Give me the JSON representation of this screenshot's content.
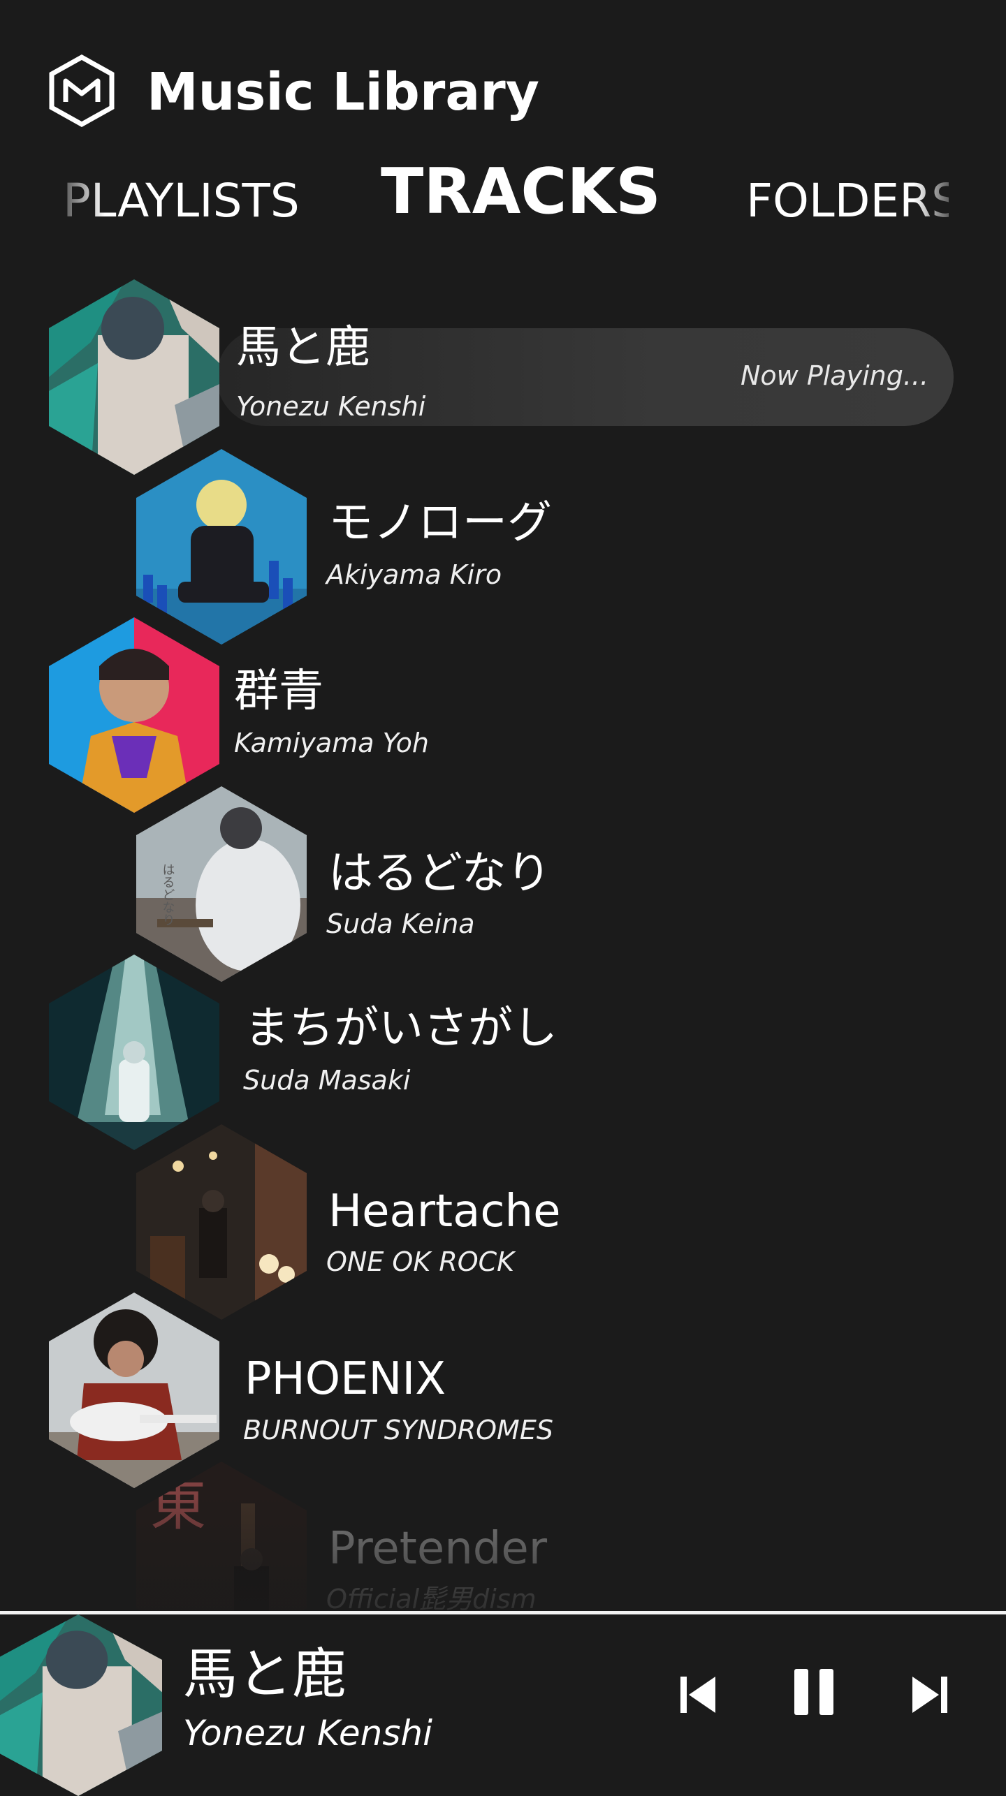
{
  "header": {
    "title": "Music Library",
    "logo_icon": "hexagon-m-logo-icon"
  },
  "tabs": [
    {
      "label": "PLAYLISTS",
      "active": false
    },
    {
      "label": "TRACKS",
      "active": true
    },
    {
      "label": "FOLDERS",
      "active": false
    }
  ],
  "now_playing_label": "Now Playing...",
  "tracks": [
    {
      "title": "馬と鹿",
      "artist": "Yonezu Kenshi",
      "playing": true
    },
    {
      "title": "モノローグ",
      "artist": "Akiyama Kiro"
    },
    {
      "title": "群青",
      "artist": "Kamiyama Yoh"
    },
    {
      "title": "はるどなり",
      "artist": "Suda Keina",
      "art_text": "はるどなり"
    },
    {
      "title": "まちがいさがし",
      "artist": "Suda Masaki"
    },
    {
      "title": "Heartache",
      "artist": "ONE OK ROCK"
    },
    {
      "title": "PHOENIX",
      "artist": "BURNOUT SYNDROMES"
    },
    {
      "title": "Pretender",
      "artist": "Official髭男dism",
      "art_text": "東"
    }
  ],
  "player": {
    "title": "馬と鹿",
    "artist": "Yonezu Kenshi",
    "controls": [
      "skip-previous-icon",
      "pause-icon",
      "skip-next-icon"
    ]
  },
  "colors": {
    "background": "#1b1b1b",
    "pill": "#383838",
    "text": "#ffffff"
  }
}
